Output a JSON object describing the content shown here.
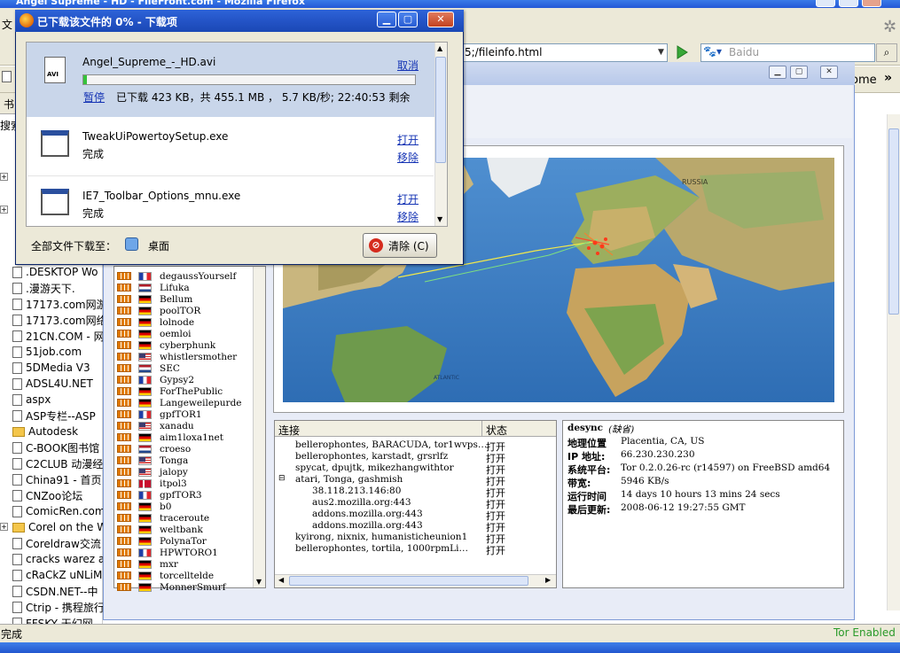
{
  "firefox": {
    "window_title": "Angel Supreme - HD - FileFront.com - Mozilla Firefox",
    "menu_first": "文",
    "url": "5;/fileinfo.html",
    "search_placeholder": "Baidu",
    "bookmarks_more": "ome",
    "status": "完成",
    "tor_status": "Tor Enabled"
  },
  "sidebar": {
    "header_left": "书",
    "search_label": "搜索",
    "items": [
      {
        "label": ".DESKTOP Wo",
        "type": "page"
      },
      {
        "label": ".漫游天下.",
        "type": "page"
      },
      {
        "label": "17173.com网游",
        "type": "page"
      },
      {
        "label": "17173.com网络",
        "type": "page"
      },
      {
        "label": "21CN.COM - 网",
        "type": "page"
      },
      {
        "label": "51job.com",
        "type": "page"
      },
      {
        "label": "5DMedia V3",
        "type": "page"
      },
      {
        "label": "ADSL4U.NET",
        "type": "page"
      },
      {
        "label": "aspx",
        "type": "page"
      },
      {
        "label": "ASP专栏--ASP",
        "type": "page"
      },
      {
        "label": "Autodesk",
        "type": "folder"
      },
      {
        "label": "C-BOOK图书馆",
        "type": "page"
      },
      {
        "label": "C2CLUB 动漫经",
        "type": "page"
      },
      {
        "label": "China91 - 首页",
        "type": "page"
      },
      {
        "label": "CNZoo论坛",
        "type": "page"
      },
      {
        "label": "ComicRen.com",
        "type": "page"
      },
      {
        "label": "Corel on the W",
        "type": "folder"
      },
      {
        "label": "Coreldraw交流",
        "type": "page"
      },
      {
        "label": "cracks warez a",
        "type": "page"
      },
      {
        "label": "cRaCkZ uNLiMi",
        "type": "page"
      },
      {
        "label": "CSDN.NET--中",
        "type": "page"
      },
      {
        "label": "Ctrip - 携程旅行",
        "type": "page"
      },
      {
        "label": "FFSKY 天幻网",
        "type": "page"
      }
    ]
  },
  "download_window": {
    "title": "已下载该文件的 0% - 下载项",
    "items": [
      {
        "name": "Angel_Supreme_-_HD.avi",
        "action": "取消",
        "pause": "暂停",
        "progress_text": "已下载 423 KB，共 455.1 MB ， 5.7 KB/秒;  22:40:53 剩余",
        "progress": 0.01
      },
      {
        "name": "TweakUiPowertoySetup.exe",
        "status": "完成",
        "open": "打开",
        "remove": "移除"
      },
      {
        "name": "IE7_Toolbar_Options_mnu.exe",
        "status": "完成",
        "open": "打开",
        "remove": "移除"
      }
    ],
    "footer_label": "全部文件下载至：",
    "folder": "桌面",
    "clear_button": "清除 (C)"
  },
  "relays": [
    {
      "name": "degaussYourself",
      "flag": "fr"
    },
    {
      "name": "Lifuka",
      "flag": "nl"
    },
    {
      "name": "Bellum",
      "flag": "de"
    },
    {
      "name": "poolTOR",
      "flag": "de"
    },
    {
      "name": "lolnode",
      "flag": "de"
    },
    {
      "name": "oemloi",
      "flag": "de"
    },
    {
      "name": "cyberphunk",
      "flag": "de"
    },
    {
      "name": "whistlersmother",
      "flag": "us"
    },
    {
      "name": "SEC",
      "flag": "nl"
    },
    {
      "name": "Gypsy2",
      "flag": "fr"
    },
    {
      "name": "ForThePublic",
      "flag": "de"
    },
    {
      "name": "Langeweilepurde",
      "flag": "de"
    },
    {
      "name": "gpfTOR1",
      "flag": "fr"
    },
    {
      "name": "xanadu",
      "flag": "us"
    },
    {
      "name": "aim1loxa1net",
      "flag": "de"
    },
    {
      "name": "croeso",
      "flag": "nl"
    },
    {
      "name": "Tonga",
      "flag": "us"
    },
    {
      "name": "jalopy",
      "flag": "us"
    },
    {
      "name": "itpol3",
      "flag": "dk"
    },
    {
      "name": "gpfTOR3",
      "flag": "fr"
    },
    {
      "name": "b0",
      "flag": "de"
    },
    {
      "name": "traceroute",
      "flag": "de"
    },
    {
      "name": "weltbank",
      "flag": "de"
    },
    {
      "name": "PolynaTor",
      "flag": "de"
    },
    {
      "name": "HPWTORO1",
      "flag": "fr"
    },
    {
      "name": "mxr",
      "flag": "de"
    },
    {
      "name": "torcelltelde",
      "flag": "de"
    },
    {
      "name": "MonnerSmurf",
      "flag": "de"
    }
  ],
  "connections": {
    "col_connection": "连接",
    "col_status": "状态",
    "rows": [
      {
        "text": "bellerophontes, BARACUDA, tor1wvps…",
        "status": "打开",
        "indent": 0
      },
      {
        "text": "bellerophontes, karstadt, grsrlfz",
        "status": "打开",
        "indent": 0
      },
      {
        "text": "spycat, dpujtk, mikezhangwithtor",
        "status": "打开",
        "indent": 0
      },
      {
        "text": "atari, Tonga, gashmish",
        "status": "打开",
        "indent": 0,
        "expanded": true
      },
      {
        "text": "38.118.213.146:80",
        "status": "打开",
        "indent": 1
      },
      {
        "text": "aus2.mozilla.org:443",
        "status": "打开",
        "indent": 1
      },
      {
        "text": "addons.mozilla.org:443",
        "status": "打开",
        "indent": 1
      },
      {
        "text": "addons.mozilla.org:443",
        "status": "打开",
        "indent": 1
      },
      {
        "text": "kyirong, nixnix, humanisticheunion1",
        "status": "打开",
        "indent": 0
      },
      {
        "text": "bellerophontes, tortila, 1000rpmLi…",
        "status": "打开",
        "indent": 0
      }
    ]
  },
  "relay_detail": {
    "name": "desync",
    "name_suffix": "(缺省)",
    "location_label": "地理位置",
    "location": "Placentia, CA, US",
    "ip_label": "IP 地址:",
    "ip": "66.230.230.230",
    "platform_label": "系统平台:",
    "platform": "Tor 0.2.0.26-rc (r14597) on FreeBSD amd64",
    "bandwidth_label": "带宽:",
    "bandwidth": "5946 KB/s",
    "uptime_label": "运行时间",
    "uptime": "14 days 10 hours 13 mins 24 secs",
    "updated_label": "最后更新:",
    "updated": "2008-06-12 19:27:55 GMT"
  },
  "icons": [
    "firefox-icon",
    "go-arrow-icon",
    "search-icon",
    "page-icon",
    "folder-icon",
    "avi-file-icon",
    "exe-file-icon",
    "stop-icon",
    "bandwidth-bars-icon",
    "flag-icon"
  ]
}
